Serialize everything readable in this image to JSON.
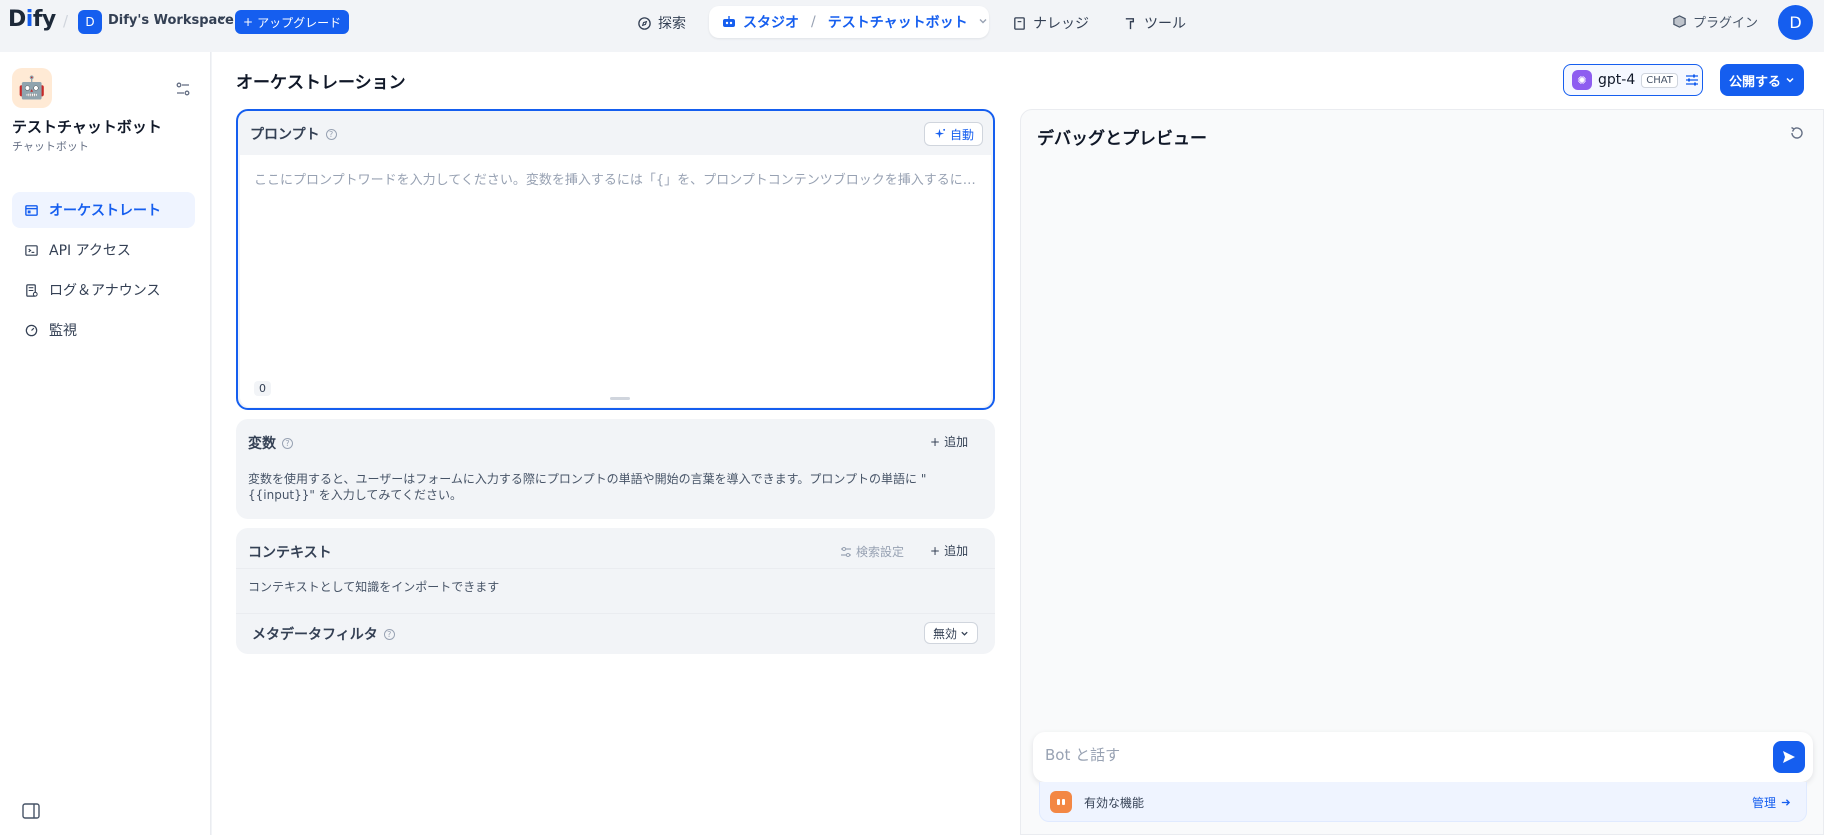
{
  "header": {
    "logo": "Dify",
    "workspace_initial": "D",
    "workspace_name": "Dify's Workspace",
    "upgrade_label": "アップグレード",
    "nav": {
      "explore": "探索",
      "studio": "スタジオ",
      "app_name": "テストチャットボット",
      "knowledge": "ナレッジ",
      "tools": "ツール"
    },
    "plugins": "プラグイン",
    "user_initial": "D"
  },
  "sidebar": {
    "app_name": "テストチャットボット",
    "app_type": "チャットボット",
    "items": [
      {
        "label": "オーケストレート",
        "icon": "layout-icon",
        "active": true
      },
      {
        "label": "API アクセス",
        "icon": "terminal-icon",
        "active": false
      },
      {
        "label": "ログ＆アナウンス",
        "icon": "file-list-icon",
        "active": false
      },
      {
        "label": "監視",
        "icon": "dashboard-icon",
        "active": false
      }
    ]
  },
  "main": {
    "title": "オーケストレーション",
    "model": {
      "name": "gpt-4",
      "mode": "CHAT"
    },
    "publish_label": "公開する",
    "prompt": {
      "title": "プロンプト",
      "auto_label": "自動",
      "placeholder": "ここにプロンプトワードを入力してください。変数を挿入するには「{」を、プロンプトコンテンツブロックを挿入するには「/」を入力します。",
      "char_count": "0"
    },
    "variables": {
      "title": "変数",
      "add_label": "追加",
      "description": "変数を使用すると、ユーザーはフォームに入力する際にプロンプトの単語や開始の言葉を導入できます。プロンプトの単語に \"{{input}}\" を入力してみてください。"
    },
    "context": {
      "title": "コンテキスト",
      "retrieval_label": "検索設定",
      "add_label": "追加",
      "description": "コンテキストとして知識をインポートできます",
      "metadata_filter": "メタデータフィルタ",
      "metadata_value": "無効"
    }
  },
  "debug": {
    "title": "デバッグとプレビュー",
    "input_placeholder": "Bot と話す",
    "features_label": "有効な機能",
    "manage_label": "管理"
  },
  "colors": {
    "accent": "#155eef",
    "background": "#f2f4f7"
  }
}
